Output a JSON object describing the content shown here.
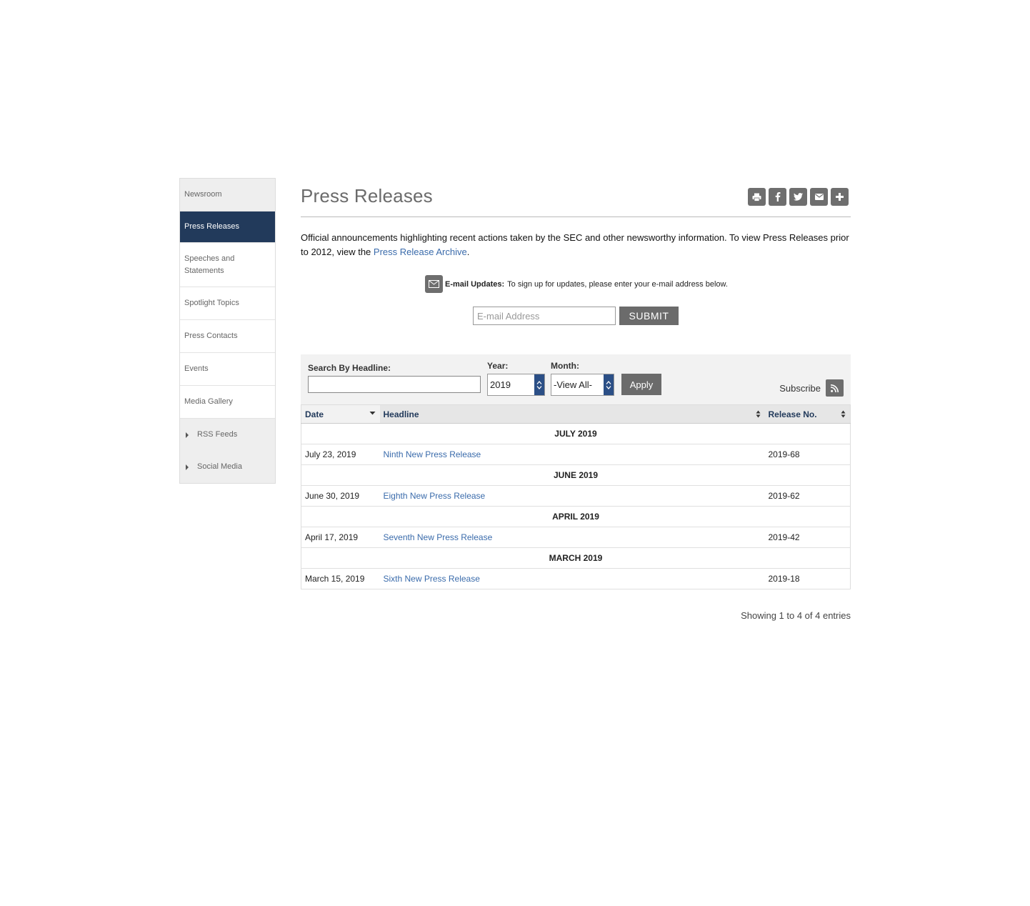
{
  "sidebar": {
    "items": [
      {
        "label": "Newsroom"
      },
      {
        "label": "Press Releases"
      },
      {
        "label": "Speeches and Statements"
      },
      {
        "label": "Spotlight Topics"
      },
      {
        "label": "Press Contacts"
      },
      {
        "label": "Events"
      },
      {
        "label": "Media Gallery"
      },
      {
        "label": "RSS Feeds"
      },
      {
        "label": "Social Media"
      }
    ]
  },
  "header": {
    "title": "Press Releases",
    "share_icons": [
      "print-icon",
      "facebook-icon",
      "twitter-icon",
      "envelope-icon",
      "plus-icon"
    ]
  },
  "intro": {
    "text": "Official announcements highlighting recent actions taken by the SEC and other newsworthy information.  To view Press Releases prior to 2012, view the ",
    "link": "Press Release Archive",
    "end": "."
  },
  "email_updates": {
    "label": "E-mail Updates:",
    "text": "To sign up for updates, please enter your e-mail address below.",
    "placeholder": "E-mail Address",
    "submit": "SUBMIT"
  },
  "filters": {
    "headline_label": "Search By Headline:",
    "headline_value": "",
    "year_label": "Year:",
    "year_value": "2019",
    "month_label": "Month:",
    "month_value": "-View All-",
    "apply": "Apply",
    "subscribe": "Subscribe"
  },
  "table": {
    "columns": [
      "Date",
      "Headline",
      "Release No."
    ],
    "groups": [
      {
        "heading": "JULY 2019",
        "rows": [
          {
            "date": "July 23, 2019",
            "headline": "Ninth New Press Release",
            "release": "2019-68"
          }
        ]
      },
      {
        "heading": "JUNE 2019",
        "rows": [
          {
            "date": "June 30, 2019",
            "headline": "Eighth New Press Release",
            "release": "2019-62"
          }
        ]
      },
      {
        "heading": "APRIL 2019",
        "rows": [
          {
            "date": "April 17, 2019",
            "headline": "Seventh New Press Release",
            "release": "2019-42"
          }
        ]
      },
      {
        "heading": "MARCH 2019",
        "rows": [
          {
            "date": "March 15, 2019",
            "headline": "Sixth New Press Release",
            "release": "2019-18"
          }
        ]
      }
    ],
    "info": "Showing 1 to 4 of 4 entries"
  },
  "colors": {
    "accent_nav": "#223a5b",
    "link": "#3a6bab",
    "button_gray": "#6b6b6b"
  }
}
